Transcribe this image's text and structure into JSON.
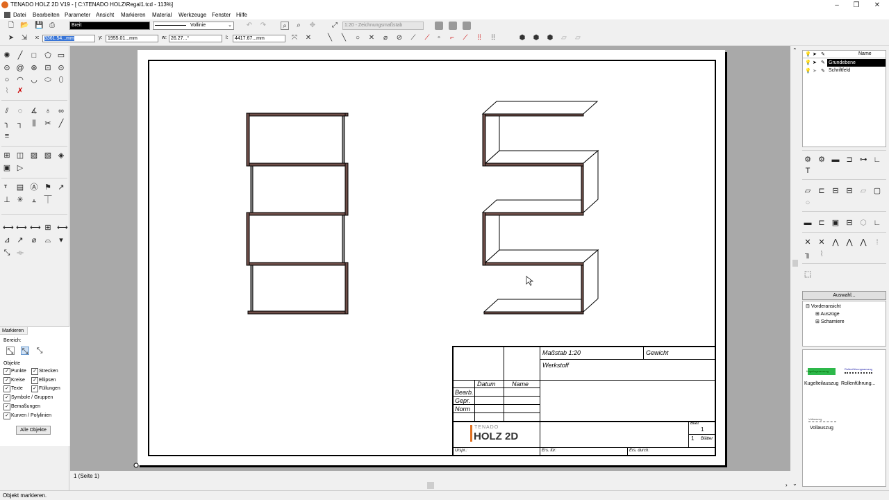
{
  "window": {
    "title": "TENADO HOLZ 2D V19 - [ C:\\TENADO HOLZ\\Regal1.tcd - 113%]"
  },
  "menu": [
    "Datei",
    "Bearbeiten",
    "Parameter",
    "Ansicht",
    "Markieren",
    "Material",
    "Werkzeuge",
    "Fenster",
    "Hilfe"
  ],
  "toolbar": {
    "pen_width": "Breit",
    "line_type": "Vollinie",
    "scale": "1:20 - Zeichnungsmaßstab"
  },
  "coords": {
    "x_label": "x:",
    "x_value": "3361.54...mm",
    "y_label": "y:",
    "y_value": "1955.01...mm",
    "w_label": "w:",
    "w_value": "26.27...°",
    "l_label": "l:",
    "l_value": "4417.67...mm"
  },
  "markieren": {
    "tab": "Markieren",
    "bereich": "Bereich:",
    "objekte": "Objekte",
    "items": [
      "Punkte",
      "Strecken",
      "Kreise",
      "Ellipsen",
      "Texte",
      "Füllungen",
      "Symbole / Gruppen",
      "Bemaßungen",
      "Kurven / Polylinien"
    ],
    "button": "Alle Objekte"
  },
  "layers": {
    "header": "Name",
    "items": [
      "Grundebene",
      "Schriftfeld"
    ]
  },
  "auswahl_button": "Auswahl...",
  "tree": {
    "root": "Vorderansicht",
    "children": [
      "Auszüge",
      "Scharniere"
    ]
  },
  "symbols": {
    "items": [
      "Kugelteilauszug",
      "Rollenführung...",
      "Vollauszug"
    ],
    "sub_labels": [
      "Kugellagerauszug",
      "Rollenführungsauszug",
      "Vollauszug"
    ]
  },
  "titleblock": {
    "massstab": "Maßstab 1:20",
    "gewicht": "Gewicht",
    "werkstoff": "Werkstoff",
    "datum": "Datum",
    "name": "Name",
    "rows": [
      "Bearb.",
      "Gepr.",
      "Norm"
    ],
    "logo_top": "TENADO",
    "logo_main": "HOLZ 2D",
    "blatt_label": "Blatt",
    "blatt_value": "1",
    "blaetter_value": "1",
    "blaetter_label": "Blätter",
    "urspr": "Urspr.:",
    "ers_fuer": "Ers. für:",
    "ers_durch": "Ers. durch:"
  },
  "page_tab": "1 (Seite 1)",
  "status": "Objekt markieren."
}
